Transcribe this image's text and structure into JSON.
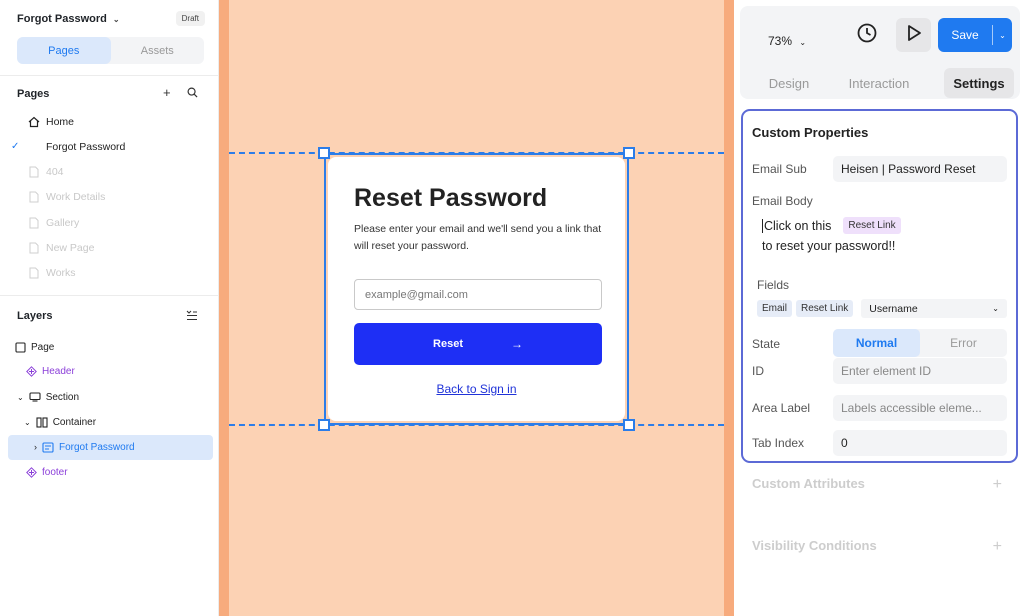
{
  "project": {
    "title": "Forgot Password",
    "badge": "Draft"
  },
  "left_tabs": [
    "Pages",
    "Assets"
  ],
  "pages_section": {
    "title": "Pages",
    "items": [
      {
        "label": "Home",
        "icon": "home-icon"
      },
      {
        "label": "Forgot Password",
        "icon": "check-icon"
      },
      {
        "label": "404",
        "icon": "page-icon"
      },
      {
        "label": "Work Details",
        "icon": "page-icon"
      },
      {
        "label": "Gallery",
        "icon": "page-icon"
      },
      {
        "label": "New Page",
        "icon": "page-icon"
      },
      {
        "label": "Works",
        "icon": "page-icon"
      }
    ]
  },
  "layers_section": {
    "title": "Layers",
    "items": [
      {
        "label": "Page",
        "icon": "square-icon"
      },
      {
        "label": "Header",
        "icon": "component-icon"
      },
      {
        "label": "Section",
        "icon": "section-icon"
      },
      {
        "label": "Container",
        "icon": "container-icon"
      },
      {
        "label": "Forgot Password",
        "icon": "form-icon"
      },
      {
        "label": "footer",
        "icon": "component-icon"
      }
    ]
  },
  "card": {
    "title": "Reset Password",
    "description": "Please enter your email and we'll send you a link that will reset your password.",
    "email_placeholder": "example@gmail.com",
    "button_label": "Reset",
    "back_link": "Back to Sign in"
  },
  "toolbar": {
    "zoom": "73%",
    "save_label": "Save"
  },
  "right_tabs": [
    "Design",
    "Interaction",
    "Settings"
  ],
  "custom_properties": {
    "title": "Custom Properties",
    "email_sub_label": "Email Sub",
    "email_sub_value": "Heisen | Password Reset",
    "email_body_label": "Email Body",
    "body_text_1": "Click on this",
    "body_chip": "Reset Link",
    "body_text_2": "to reset your password!!",
    "fields_label": "Fields",
    "field_chips": [
      "Email",
      "Reset Link"
    ],
    "field_select": "Username",
    "state_label": "State",
    "state_options": [
      "Normal",
      "Error"
    ],
    "id_label": "ID",
    "id_placeholder": "Enter element ID",
    "area_label": "Area Label",
    "area_placeholder": "Labels accessible eleme...",
    "tab_index_label": "Tab Index",
    "tab_index_value": "0"
  },
  "collapsed_sections": [
    "Custom Attributes",
    "Visibility Conditions"
  ],
  "colors": {
    "accent": "#1f7af0",
    "canvas": "#fcd2b4",
    "cta": "#1e2ff5",
    "outline": "#5c6ad6"
  }
}
